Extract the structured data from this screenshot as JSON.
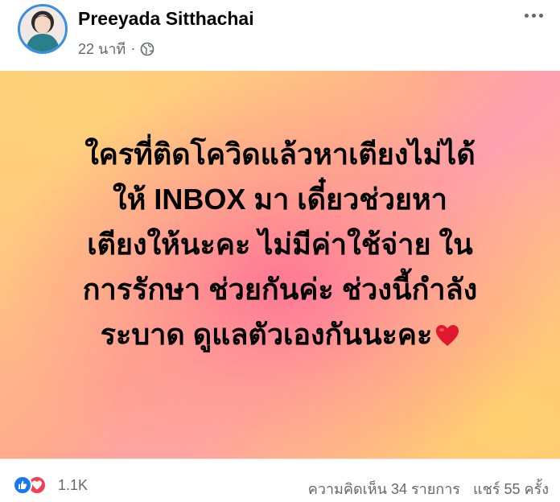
{
  "post": {
    "author": "Preeyada Sitthachai",
    "time": "22 นาที",
    "separator": "·",
    "audience_icon": "globe-icon",
    "more_icon": "more-icon"
  },
  "card": {
    "lines": [
      "ใครที่ติดโควิดแล้วหาเตียงไม่ได้",
      "ให้ INBOX มา เดี๋ยวช่วยหา",
      "เตียงให้นะคะ ไม่มีค่าใช้จ่าย ใน",
      "การรักษา ช่วยกันค่ะ ช่วงนี้กำลัง",
      "ระบาด ดูแลตัวเองกันนะคะ"
    ],
    "emoji_icon": "heart-icon",
    "colors": {
      "warm": "#ffce7e",
      "pink": "#ff9fb0",
      "heart": "#e0182d"
    }
  },
  "footer": {
    "reaction_icons": [
      "like-icon",
      "love-icon"
    ],
    "reaction_count": "1.1K",
    "comments": "ความคิดเห็น 34 รายการ",
    "shares": "แชร์ 55 ครั้ง"
  }
}
